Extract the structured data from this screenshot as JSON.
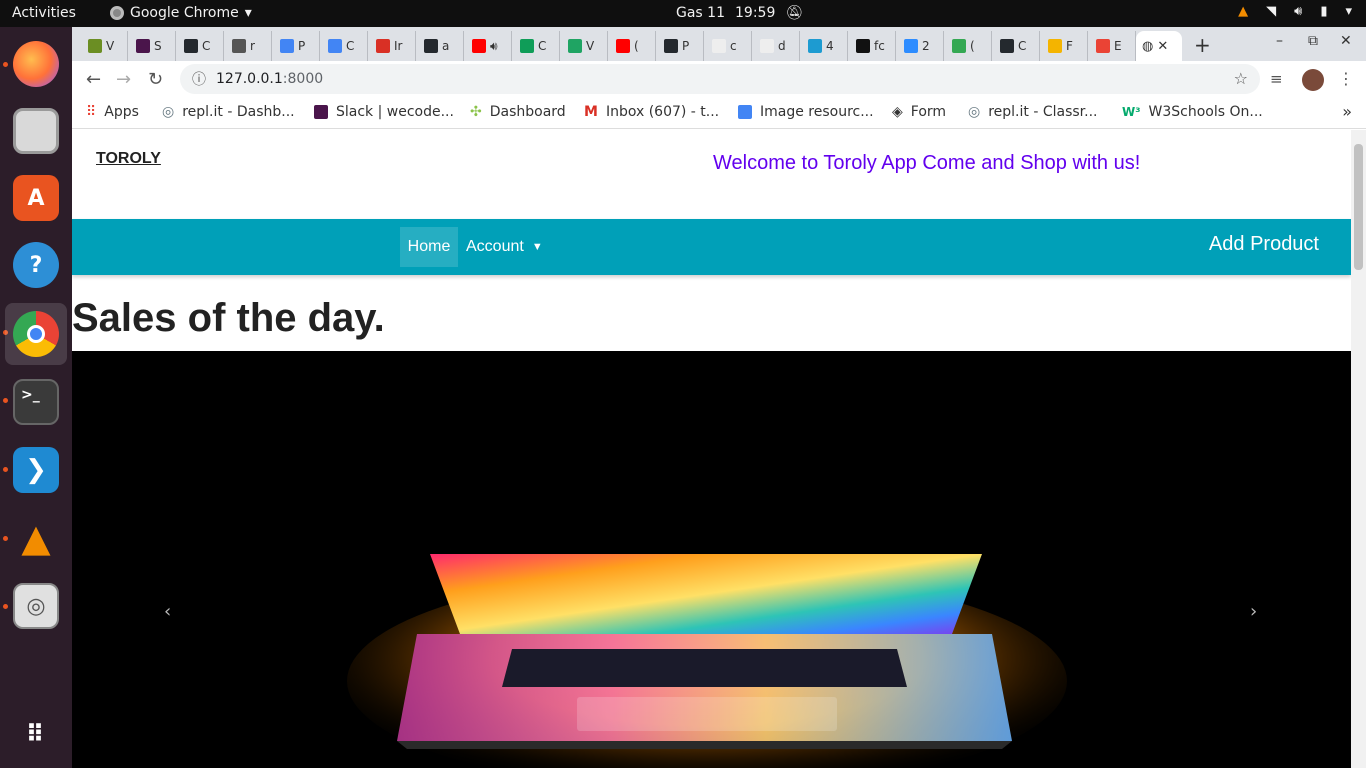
{
  "topbar": {
    "activities": "Activities",
    "app_name": "Google Chrome",
    "date": "Gas 11",
    "time": "19:59"
  },
  "dock": {
    "items": [
      {
        "name": "firefox-icon",
        "active": false,
        "running": true
      },
      {
        "name": "files-icon",
        "active": false,
        "running": false
      },
      {
        "name": "software-center-icon",
        "active": false,
        "running": false
      },
      {
        "name": "help-icon",
        "active": false,
        "running": false
      },
      {
        "name": "chrome-icon",
        "active": true,
        "running": true
      },
      {
        "name": "terminal-icon",
        "active": false,
        "running": true
      },
      {
        "name": "vscode-icon",
        "active": false,
        "running": true
      },
      {
        "name": "vlc-icon",
        "active": false,
        "running": true
      },
      {
        "name": "image-viewer-icon",
        "active": false,
        "running": true
      },
      {
        "name": "apps-grid-icon",
        "active": false,
        "running": false
      }
    ]
  },
  "browser": {
    "tabs": [
      {
        "label": "V",
        "color": "#6b8e23"
      },
      {
        "label": "S",
        "color": "#4a154b"
      },
      {
        "label": "C",
        "color": "#24292e"
      },
      {
        "label": "r",
        "color": "#555555"
      },
      {
        "label": "P",
        "color": "#4285f4"
      },
      {
        "label": "C",
        "color": "#4285f4"
      },
      {
        "label": "Ir",
        "color": "#d93025"
      },
      {
        "label": "a",
        "color": "#24292e"
      },
      {
        "label": "",
        "color": "#ff0000"
      },
      {
        "label": "C",
        "color": "#0f9d58"
      },
      {
        "label": "V",
        "color": "#1fa463"
      },
      {
        "label": "(",
        "color": "#ff0000"
      },
      {
        "label": "P",
        "color": "#24292e"
      },
      {
        "label": "c",
        "color": "#eeeeee"
      },
      {
        "label": "d",
        "color": "#eeeeee"
      },
      {
        "label": "4",
        "color": "#1d9bd1"
      },
      {
        "label": "fc",
        "color": "#111111"
      },
      {
        "label": "2",
        "color": "#2d8cff"
      },
      {
        "label": "(",
        "color": "#34a853"
      },
      {
        "label": "C",
        "color": "#24292e"
      },
      {
        "label": "F",
        "color": "#f4b400"
      },
      {
        "label": "E",
        "color": "#ea4335"
      }
    ],
    "url_host": "127.0.0.1",
    "url_port": ":8000",
    "bookmarks": [
      {
        "label": "Apps",
        "color": "#e94235"
      },
      {
        "label": "repl.it - Dashb...",
        "color": "#667881"
      },
      {
        "label": "Slack | wecode...",
        "color": "#4a154b"
      },
      {
        "label": "Dashboard",
        "color": "#8bc34a"
      },
      {
        "label": "Inbox (607) - t...",
        "color": "#d93025"
      },
      {
        "label": "Image resourc...",
        "color": "#4285f4"
      },
      {
        "label": "Form",
        "color": "#333333"
      },
      {
        "label": "repl.it - Classr...",
        "color": "#667881"
      },
      {
        "label": "W3Schools On...",
        "color": "#04aa6d"
      }
    ]
  },
  "site": {
    "brand": "TOROLY",
    "welcome": "Welcome to Toroly App Come and Shop with us!",
    "nav": {
      "home": "Home",
      "account": "Account",
      "add_product": "Add Product"
    },
    "heading": "Sales of the day.",
    "colors": {
      "navbar": "#00a0b8",
      "welcome": "#6200ee"
    }
  }
}
